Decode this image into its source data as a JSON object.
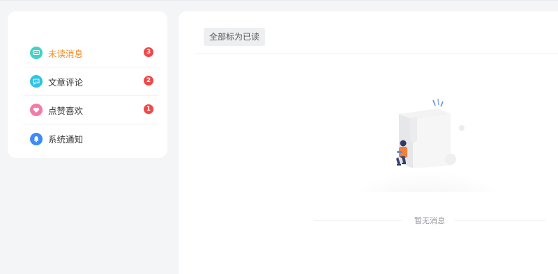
{
  "sidebar": {
    "items": [
      {
        "label": "未读消息",
        "badge": "3",
        "icon": "unread-message-icon",
        "color": "#3fd3c9"
      },
      {
        "label": "文章评论",
        "badge": "2",
        "icon": "comment-icon",
        "color": "#2ec3e8"
      },
      {
        "label": "点赞喜欢",
        "badge": "1",
        "icon": "heart-icon",
        "color": "#f47aa8"
      },
      {
        "label": "系统通知",
        "icon": "bell-icon",
        "color": "#3b8cf5"
      }
    ],
    "active_color": "#f48a1f",
    "badge_color": "#f04848"
  },
  "main": {
    "mark_all_read_label": "全部标为已读",
    "empty_text": "暂无消息"
  }
}
